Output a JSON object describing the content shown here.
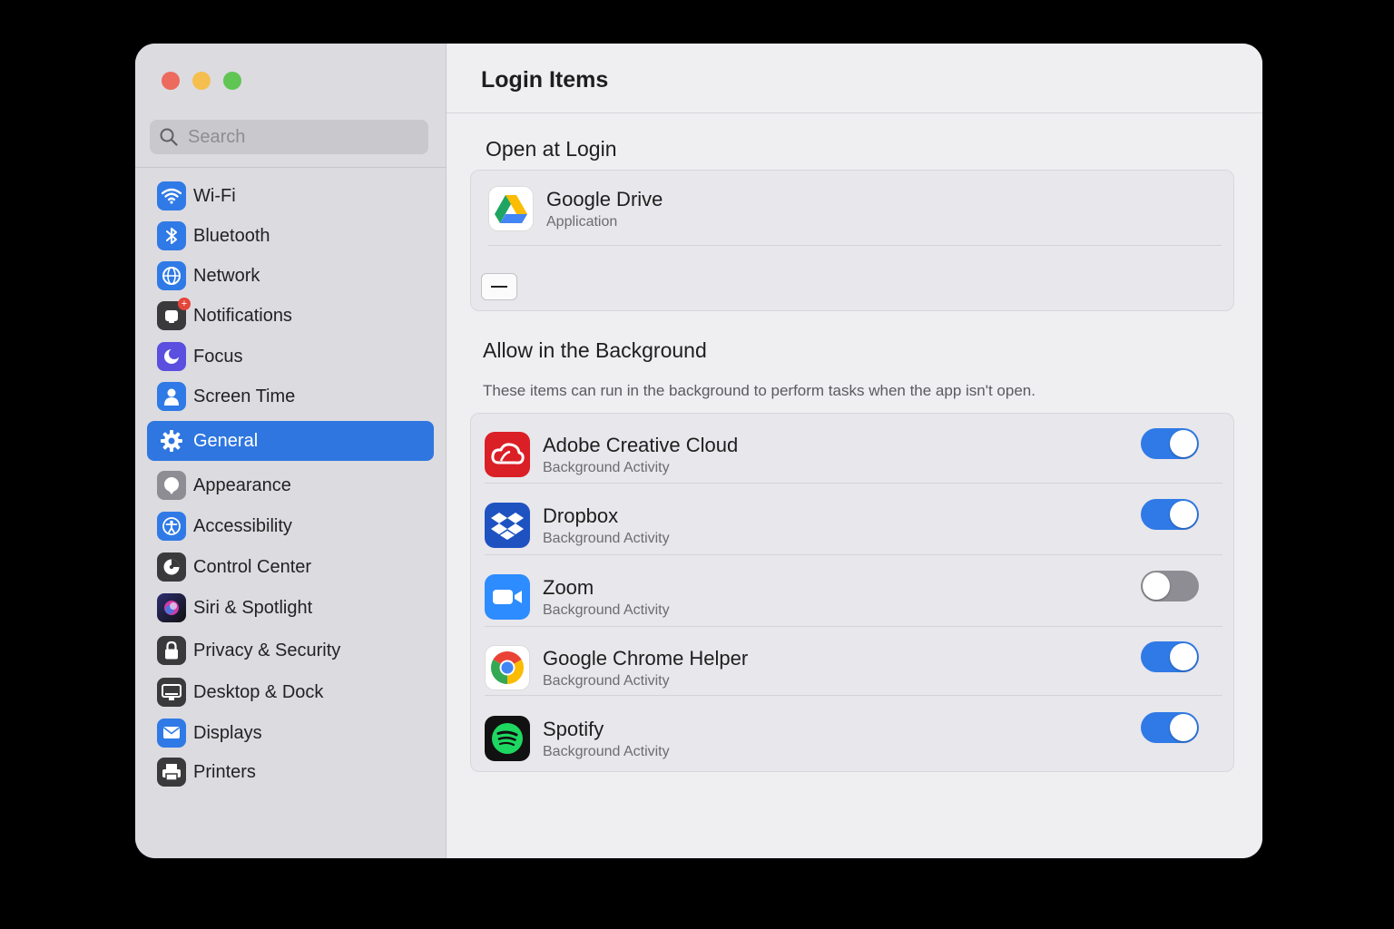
{
  "window": {
    "traffic_lights": [
      "close",
      "minimize",
      "zoom"
    ]
  },
  "sidebar": {
    "search_placeholder": "Search",
    "items": [
      {
        "label": "Wi-Fi",
        "icon": "wifi-icon",
        "color": "#2f7ae6"
      },
      {
        "label": "Bluetooth",
        "icon": "bluetooth-icon",
        "color": "#2f7ae6"
      },
      {
        "label": "Network",
        "icon": "network-globe-icon",
        "color": "#2f7ae6"
      },
      {
        "label": "Notifications",
        "icon": "notifications-bell-icon",
        "color": "#3a3a3c",
        "badge": "+"
      },
      {
        "label": "Focus",
        "icon": "focus-moon-icon",
        "color": "#5b4fe0"
      },
      {
        "label": "Screen Time",
        "icon": "screen-time-person-icon",
        "color": "#2f7ae6"
      },
      {
        "label": "General",
        "icon": "gear-icon",
        "color": "#2f76e0",
        "selected": true
      },
      {
        "label": "Appearance",
        "icon": "appearance-icon",
        "color": "#8e8d93"
      },
      {
        "label": "Accessibility",
        "icon": "accessibility-icon",
        "color": "#2f7ae6"
      },
      {
        "label": "Control Center",
        "icon": "control-center-icon",
        "color": "#3a3a3c"
      },
      {
        "label": "Siri & Spotlight",
        "icon": "siri-icon",
        "color": "#9b3fd6"
      },
      {
        "label": "Privacy & Security",
        "icon": "lock-icon",
        "color": "#3a3a3c"
      },
      {
        "label": "Desktop & Dock",
        "icon": "desktop-icon",
        "color": "#3a3a3c"
      },
      {
        "label": "Displays",
        "icon": "displays-icon",
        "color": "#2f7ae6"
      },
      {
        "label": "Printers",
        "icon": "printer-icon",
        "color": "#3a3a3c"
      }
    ]
  },
  "main": {
    "title": "Login Items",
    "open_at_login": {
      "title": "Open at Login",
      "items": [
        {
          "name": "Google Drive",
          "subtitle": "Application",
          "icon": "google-drive-icon"
        }
      ],
      "remove_button": "remove-login-item"
    },
    "background": {
      "title": "Allow in the Background",
      "description": "These items can run in the background to perform tasks when the app isn't open.",
      "items": [
        {
          "name": "Adobe Creative Cloud",
          "subtitle": "Background Activity",
          "icon": "adobe-creative-cloud-icon",
          "enabled": true
        },
        {
          "name": "Dropbox",
          "subtitle": "Background Activity",
          "icon": "dropbox-icon",
          "enabled": true
        },
        {
          "name": "Zoom",
          "subtitle": "Background Activity",
          "icon": "zoom-icon",
          "enabled": false
        },
        {
          "name": "Google Chrome Helper",
          "subtitle": "Background Activity",
          "icon": "chrome-icon",
          "enabled": true
        },
        {
          "name": "Spotify",
          "subtitle": "Background Activity",
          "icon": "spotify-icon",
          "enabled": true
        }
      ]
    }
  }
}
